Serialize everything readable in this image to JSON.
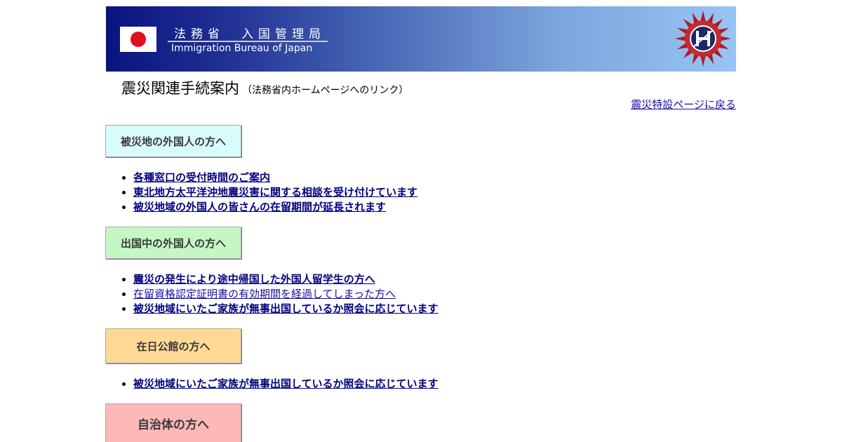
{
  "header": {
    "agency_ja": "法務省　入国管理局",
    "agency_en": "Immigration Bureau of Japan"
  },
  "page": {
    "title": "震災関連手続案内",
    "subtitle": "（法務省内ホームページへのリンク）",
    "back_link": "震災特設ページに戻る"
  },
  "colors": {
    "banner_dark": "#0a1480",
    "banner_light": "#97c5f4",
    "link": "#000080",
    "flag_red": "#e0101a"
  },
  "sections": [
    {
      "heading": "被災地の外国人の方へ",
      "links": [
        "各種窓口の受付時間のご案内",
        "東北地方太平洋沖地震災害に関する相談を受け付けています",
        "被災地域の外国人の皆さんの在留期間が延長されます"
      ]
    },
    {
      "heading": "出国中の外国人の方へ",
      "links": [
        "震災の発生により途中帰国した外国人留学生の方へ",
        "在留資格認定証明書の有効期間を経過してしまった方へ",
        "被災地域にいたご家族が無事出国しているか照会に応じています"
      ]
    },
    {
      "heading": "在日公館の方へ",
      "links": [
        "被災地域にいたご家族が無事出国しているか照会に応じています"
      ]
    },
    {
      "heading": "自治体の方へ",
      "links": []
    }
  ]
}
